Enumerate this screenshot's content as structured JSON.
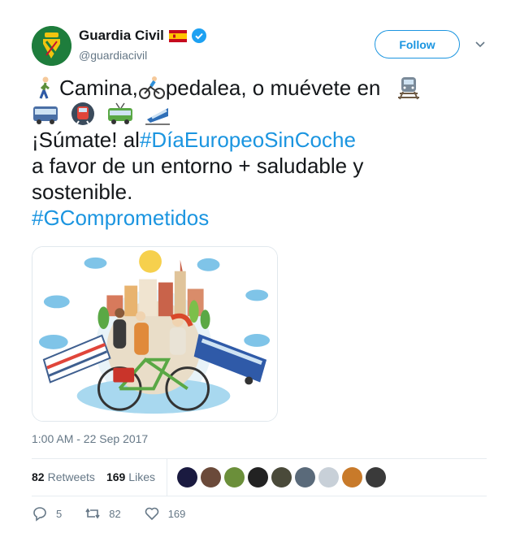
{
  "author": {
    "display_name": "Guardia Civil",
    "handle": "@guardiacivil",
    "avatar": "guardia-civil-logo",
    "verified": true,
    "flag": "spain-flag"
  },
  "follow_label": "Follow",
  "tweet": {
    "line1_a": "Camina, ",
    "line1_b": "pedalea, o muévete en",
    "line3_a": "¡Súmate! al ",
    "hashtag1": "#DíaEuropeoSinCoche",
    "line4": "a favor de un entorno + saludable y",
    "line5": "sostenible.",
    "hashtag2": "#GComprometidos",
    "emojis": [
      "walking-person-emoji",
      "cyclist-emoji",
      "train-station-emoji",
      "bus-emoji",
      "metro-emoji",
      "trolleybus-emoji",
      "tram-emoji"
    ]
  },
  "timestamp": "1:00 AM - 22 Sep 2017",
  "stats": {
    "retweets_count": "82",
    "retweets_label": "Retweets",
    "likes_count": "169",
    "likes_label": "Likes"
  },
  "actions": {
    "replies": "5",
    "retweets": "82",
    "likes": "169"
  },
  "colors": {
    "link": "#1b95e0",
    "text": "#14171a",
    "muted": "#657786",
    "avatar_bg": "#1e7d3c"
  }
}
